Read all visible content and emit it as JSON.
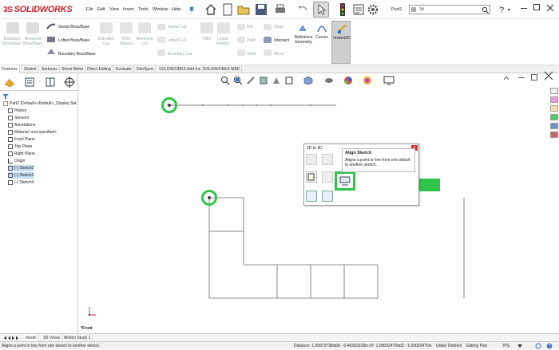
{
  "app": {
    "brand_ds": "3S",
    "brand_name": "SOLIDWORKS"
  },
  "menu": [
    "File",
    "Edit",
    "View",
    "Insert",
    "Tools",
    "Window",
    "Help"
  ],
  "doc_title": "Part2",
  "search": {
    "value": "3d"
  },
  "ribbon": {
    "extruded_boss": "Extruded Boss/Base",
    "revolved_boss": "Revolved Boss/Base",
    "swept_boss": "Swept Boss/Base",
    "lofted_boss": "Lofted Boss/Base",
    "boundary_boss": "Boundary Boss/Base",
    "extruded_cut": "Extruded Cut",
    "hole_wizard": "Hole Wizard",
    "revolved_cut": "Revolved Cut",
    "swept_cut": "Swept Cut",
    "lofted_cut": "Lofted Cut",
    "boundary_cut": "Boundary Cut",
    "fillet": "Fillet",
    "linear_pattern": "Linear Pattern",
    "rib": "Rib",
    "draft": "Draft",
    "shell": "Shell",
    "wrap": "Wrap",
    "intersect": "Intersect",
    "mirror": "Mirror",
    "reference_geometry": "Reference Geometry",
    "curves": "Curves",
    "instant3d": "Instant3D"
  },
  "tabs": [
    "Features",
    "Sketch",
    "Surfaces",
    "Sheet Metal",
    "Direct Editing",
    "Evaluate",
    "DimXpert",
    "SOLIDWORKS Add-Ins",
    "SOLIDWORKS MBD"
  ],
  "tree": {
    "root": "Part2  (Default<<Default>_Display Sta",
    "items": [
      "History",
      "Sensors",
      "Annotations",
      "Material <not specified>",
      "Front Plane",
      "Top Plane",
      "Right Plane",
      "Origin",
      "(-) Sketch2",
      "(-) Sketch3",
      "(-) Sketch4"
    ]
  },
  "dialog": {
    "title": "2D to 3D",
    "tooltip_title": "Align Sketch",
    "tooltip_body": "Aligns a point or line from one sketch to another sketch."
  },
  "view_label": "*Front",
  "bottom_tabs": [
    "Model",
    "3D Views",
    "Motion Study 1"
  ],
  "status": {
    "hint": "Aligns a point or line from one sketch to another sketch.",
    "distance": "Distance: 1.69973738in",
    "dx": "dX: -0.46362328in",
    "dy": "dY: 1.09002475in",
    "dz": "dZ: -1.09002475in",
    "state": "Under Defined",
    "mode": "Editing Part",
    "units": "IPS"
  },
  "colors": {
    "brand": "#d0202a",
    "highlight": "#2ec44a",
    "selection": "#c7ddf2"
  }
}
